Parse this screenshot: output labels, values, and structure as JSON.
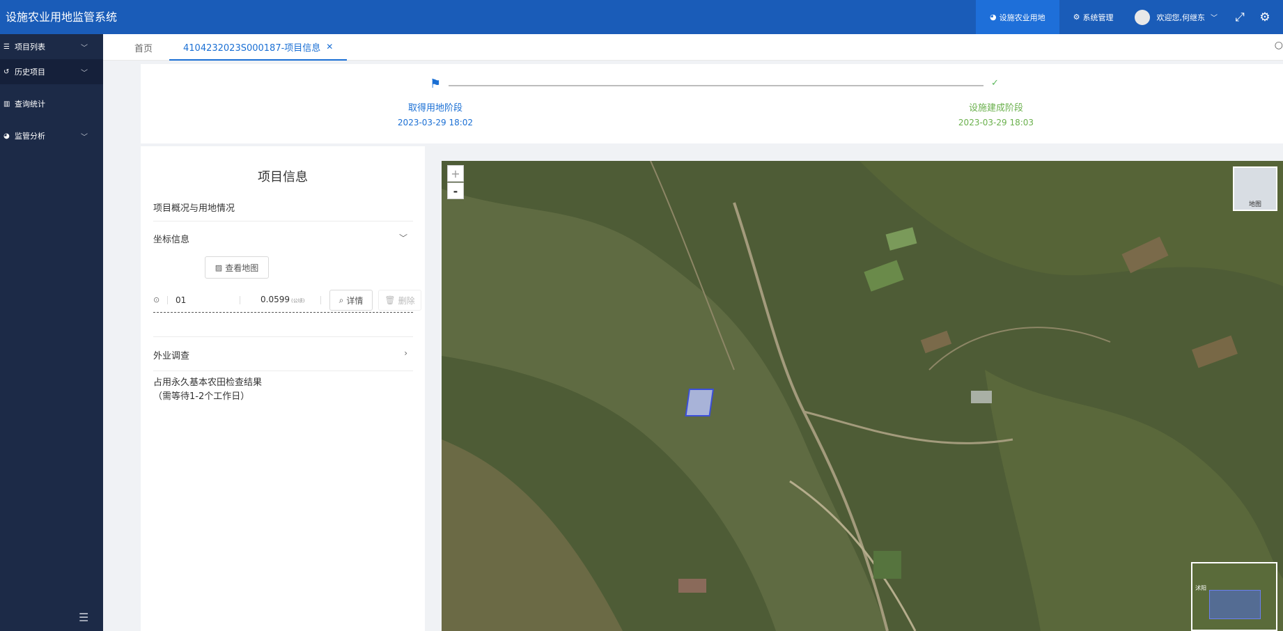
{
  "app": {
    "title": "设施农业用地监管系统"
  },
  "top_nav": {
    "items": [
      {
        "label": "设施农业用地",
        "icon": "pie-chart-icon",
        "active": true
      },
      {
        "label": "系统管理",
        "icon": "gears-icon",
        "active": false
      }
    ],
    "user": {
      "greeting": "欢迎您,何继东"
    },
    "fullscreen_icon": "expand-icon",
    "settings_icon": "gear-icon"
  },
  "sidebar": {
    "items": [
      {
        "label": "项目列表",
        "icon": "list-icon",
        "expandable": true
      },
      {
        "label": "历史项目",
        "icon": "history-icon",
        "expandable": true
      },
      {
        "label": "查询统计",
        "icon": "bar-chart-icon",
        "expandable": false
      },
      {
        "label": "监管分析",
        "icon": "pie-chart-icon",
        "expandable": true
      }
    ]
  },
  "tabs": {
    "home": "首页",
    "active": "4104232023S000187-项目信息"
  },
  "stepper": {
    "steps": [
      {
        "label": "取得用地阶段",
        "date": "2023-03-29 18:02"
      },
      {
        "label": "设施建成阶段",
        "date": "2023-03-29 18:03"
      }
    ]
  },
  "project_info": {
    "title": "项目信息",
    "overview_label": "项目概况与用地情况",
    "coordinate_label": "坐标信息",
    "view_map_button": "查看地图",
    "coordinate_row": {
      "code": "01",
      "area": "0.0599",
      "unit": "(公顷)",
      "detail_button": "详情",
      "delete_button": "删除"
    },
    "field_survey_label": "外业调查",
    "check_result_line1": "占用永久基本农田检查结果",
    "check_result_line2": "（需等待1-2个工作日）"
  },
  "map": {
    "zoom_in": "+",
    "zoom_out": "-",
    "layer_switch_label": "地图",
    "overview_label": "沭阳"
  }
}
